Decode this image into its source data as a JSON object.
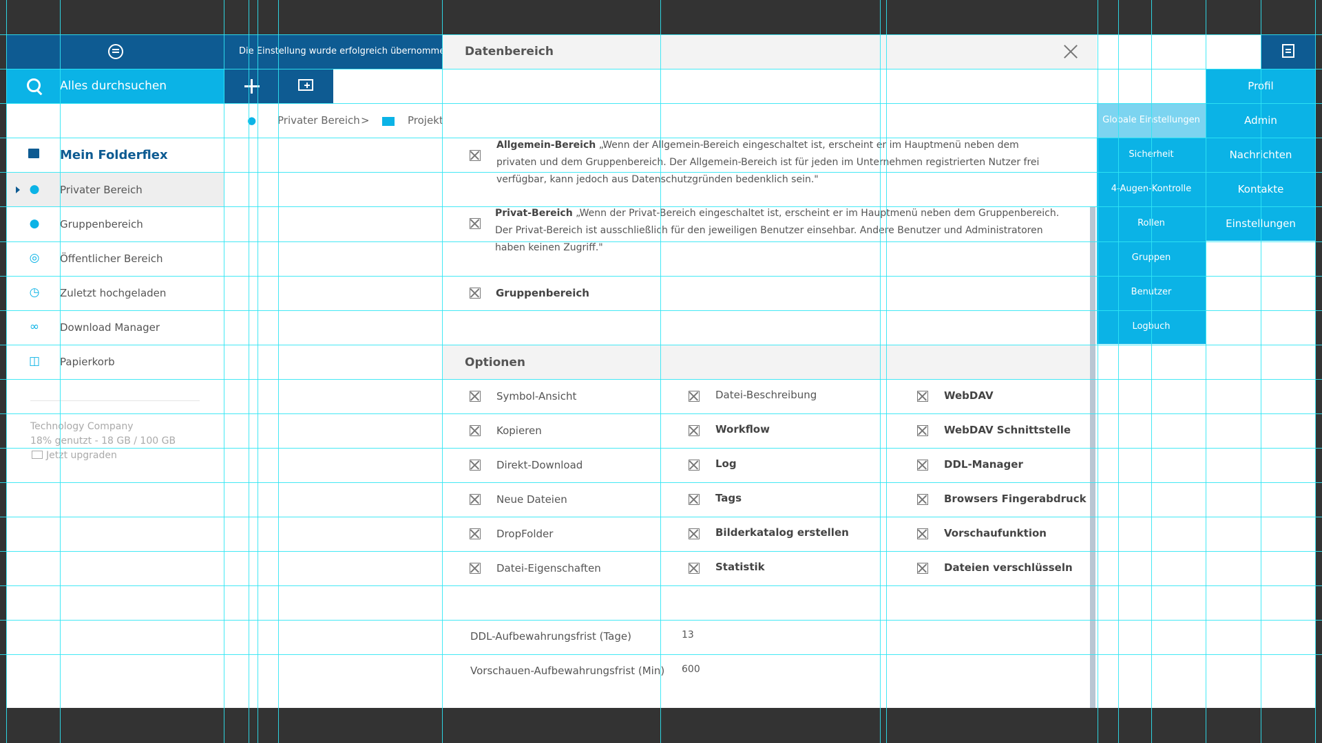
{
  "topbar": {
    "notification": "Die Einstellung wurde erfolgreich übernommen. D",
    "search_placeholder": "Alles durchsuchen"
  },
  "sidebar": {
    "title": "Mein Folderflex",
    "items": [
      {
        "label": "Privater Bereich",
        "icon": "user-icon"
      },
      {
        "label": "Gruppenbereich",
        "icon": "group-icon"
      },
      {
        "label": "Öffentlicher Bereich",
        "icon": "globe-icon"
      },
      {
        "label": "Zuletzt hochgeladen",
        "icon": "clock-icon"
      },
      {
        "label": "Download Manager",
        "icon": "link-icon"
      },
      {
        "label": "Papierkorb",
        "icon": "trash-icon"
      }
    ],
    "company": "Technology Company",
    "usage": "18% genutzt - 18 GB / 100 GB",
    "upgrade": "Jetzt upgraden"
  },
  "breadcrumb": {
    "item1": "Privater Bereich",
    "separator": ">",
    "item2": "Projekte"
  },
  "dialog": {
    "title": "Datenbereich",
    "allgemein_title": "Allgemein-Bereich",
    "allgemein_text": " „Wenn der Allgemein-Bereich eingeschaltet ist, erscheint er im Hauptmenü neben dem privaten und dem Gruppenbereich. Der Allgemein-Bereich ist für jeden im Unternehmen registrierten Nutzer frei verfügbar, kann jedoch aus Datenschutzgründen bedenklich sein.\"",
    "privat_title": "Privat-Bereich",
    "privat_text": " „Wenn der Privat-Bereich eingeschaltet ist, erscheint er im Hauptmenü neben dem Gruppenbereich. Der Privat-Bereich ist ausschließlich für den jeweiligen Benutzer einsehbar. Andere Benutzer und Administratoren haben keinen Zugriff.\"",
    "gruppen_title": "Gruppenbereich",
    "options_title": "Optionen",
    "options_col1": [
      "Symbol-Ansicht",
      "Kopieren",
      "Direkt-Download",
      "Neue Dateien",
      "DropFolder",
      "Datei-Eigenschaften"
    ],
    "options_col2": [
      "Datei-Beschreibung",
      "Workflow",
      "Log",
      "Tags",
      "Bilderkatalog erstellen",
      "Statistik"
    ],
    "options_col3": [
      "WebDAV",
      "WebDAV Schnittstelle",
      "DDL-Manager",
      "Browsers Fingerabdruck",
      "Vorschaufunktion",
      "Dateien verschlüsseln"
    ],
    "ddl_label": "DDL-Aufbewahrungsfrist (Tage)",
    "ddl_value": "13",
    "preview_label": "Vorschauen-Aufbewahrungsfrist (Min)",
    "preview_value": "600"
  },
  "admin_nav": {
    "globale": "Globale Einstellungen",
    "sicherheit": "Sicherheit",
    "augen": "4-Augen-Kontrolle",
    "rollen": "Rollen",
    "gruppen": "Gruppen",
    "benutzer": "Benutzer",
    "logbuch": "Logbuch"
  },
  "user_nav": {
    "profil": "Profil",
    "admin": "Admin",
    "nachrichten": "Nachrichten",
    "kontakte": "Kontakte",
    "einstellungen": "Einstellungen"
  },
  "colors": {
    "dark_blue": "#0e5b92",
    "light_blue": "#0bb3e6",
    "guide": "#2fe6f4"
  }
}
